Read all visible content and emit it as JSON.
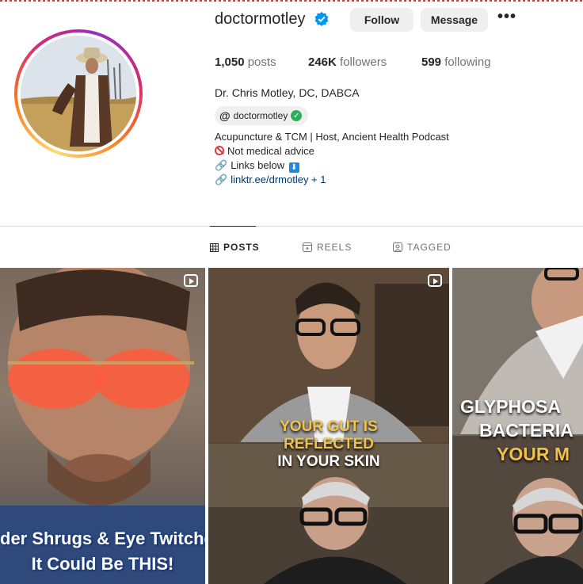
{
  "profile": {
    "username": "doctormotley",
    "follow_label": "Follow",
    "message_label": "Message",
    "more_label": "•••",
    "posts_count": "1,050",
    "posts_label": "posts",
    "followers_count": "246K",
    "followers_label": "followers",
    "following_count": "599",
    "following_label": "following",
    "full_name": "Dr. Chris Motley, DC, DABCA",
    "threads_handle": "doctormotley",
    "bio_line1": "Acupuncture & TCM | Host, Ancient Health Podcast",
    "bio_line2": "Not medical advice",
    "bio_line3": "Links below",
    "link_text": "linktr.ee/drmotley + 1"
  },
  "tabs": [
    {
      "label": "POSTS",
      "icon": "grid-icon"
    },
    {
      "label": "REELS",
      "icon": "reels-icon"
    },
    {
      "label": "TAGGED",
      "icon": "tagged-icon"
    }
  ],
  "posts": [
    {
      "caption_line1": "der Shrugs & Eye Twitches",
      "caption_line2": "It Could Be THIS!"
    },
    {
      "caption_line1": "YOUR GUT IS",
      "caption_line2": "REFLECTED",
      "caption_line3": "IN YOUR SKIN"
    },
    {
      "caption_line1": "GLYPHOSA",
      "caption_line2": "BACTERIA",
      "caption_line3": "YOUR M"
    }
  ],
  "colors": {
    "verified_blue": "#0095f6",
    "threads_check_green": "#2eae5a",
    "link_blue": "#00376b",
    "caption_yellow": "#f0c24b"
  }
}
